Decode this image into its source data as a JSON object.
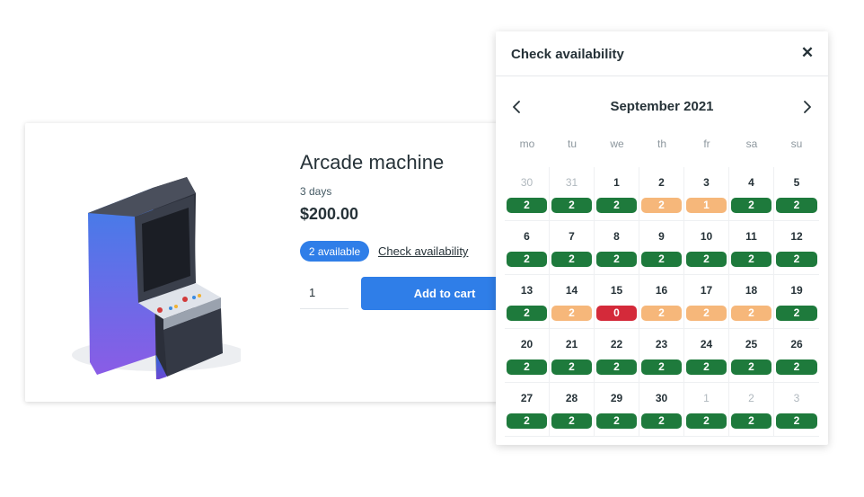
{
  "product": {
    "title": "Arcade machine",
    "duration": "3 days",
    "price": "$200.00",
    "availability_badge": "2 available",
    "check_link": "Check availability",
    "quantity": "1",
    "add_to_cart": "Add to cart",
    "image_icon": "arcade-machine-illustration"
  },
  "popup": {
    "title": "Check availability",
    "close_symbol": "✕",
    "month": "September 2021",
    "weekdays": [
      "mo",
      "tu",
      "we",
      "th",
      "fr",
      "sa",
      "su"
    ],
    "days": [
      {
        "day": "30",
        "count": "2",
        "status": "available",
        "muted": true
      },
      {
        "day": "31",
        "count": "2",
        "status": "available",
        "muted": true
      },
      {
        "day": "1",
        "count": "2",
        "status": "available",
        "muted": false
      },
      {
        "day": "2",
        "count": "2",
        "status": "partial",
        "muted": false
      },
      {
        "day": "3",
        "count": "1",
        "status": "partial",
        "muted": false
      },
      {
        "day": "4",
        "count": "2",
        "status": "available",
        "muted": false
      },
      {
        "day": "5",
        "count": "2",
        "status": "available",
        "muted": false
      },
      {
        "day": "6",
        "count": "2",
        "status": "available",
        "muted": false
      },
      {
        "day": "7",
        "count": "2",
        "status": "available",
        "muted": false
      },
      {
        "day": "8",
        "count": "2",
        "status": "available",
        "muted": false
      },
      {
        "day": "9",
        "count": "2",
        "status": "available",
        "muted": false
      },
      {
        "day": "10",
        "count": "2",
        "status": "available",
        "muted": false
      },
      {
        "day": "11",
        "count": "2",
        "status": "available",
        "muted": false
      },
      {
        "day": "12",
        "count": "2",
        "status": "available",
        "muted": false
      },
      {
        "day": "13",
        "count": "2",
        "status": "available",
        "muted": false
      },
      {
        "day": "14",
        "count": "2",
        "status": "partial",
        "muted": false
      },
      {
        "day": "15",
        "count": "0",
        "status": "unavailable",
        "muted": false
      },
      {
        "day": "16",
        "count": "2",
        "status": "partial",
        "muted": false
      },
      {
        "day": "17",
        "count": "2",
        "status": "partial",
        "muted": false
      },
      {
        "day": "18",
        "count": "2",
        "status": "partial",
        "muted": false
      },
      {
        "day": "19",
        "count": "2",
        "status": "available",
        "muted": false
      },
      {
        "day": "20",
        "count": "2",
        "status": "available",
        "muted": false
      },
      {
        "day": "21",
        "count": "2",
        "status": "available",
        "muted": false
      },
      {
        "day": "22",
        "count": "2",
        "status": "available",
        "muted": false
      },
      {
        "day": "23",
        "count": "2",
        "status": "available",
        "muted": false
      },
      {
        "day": "24",
        "count": "2",
        "status": "available",
        "muted": false
      },
      {
        "day": "25",
        "count": "2",
        "status": "available",
        "muted": false
      },
      {
        "day": "26",
        "count": "2",
        "status": "available",
        "muted": false
      },
      {
        "day": "27",
        "count": "2",
        "status": "available",
        "muted": false
      },
      {
        "day": "28",
        "count": "2",
        "status": "available",
        "muted": false
      },
      {
        "day": "29",
        "count": "2",
        "status": "available",
        "muted": false
      },
      {
        "day": "30",
        "count": "2",
        "status": "available",
        "muted": false
      },
      {
        "day": "1",
        "count": "2",
        "status": "available",
        "muted": true
      },
      {
        "day": "2",
        "count": "2",
        "status": "available",
        "muted": true
      },
      {
        "day": "3",
        "count": "2",
        "status": "available",
        "muted": true
      }
    ]
  },
  "colors": {
    "accent": "#2f7ee8",
    "available": "#1e7a3c",
    "partial": "#f6b77a",
    "unavailable": "#d42a3a"
  }
}
